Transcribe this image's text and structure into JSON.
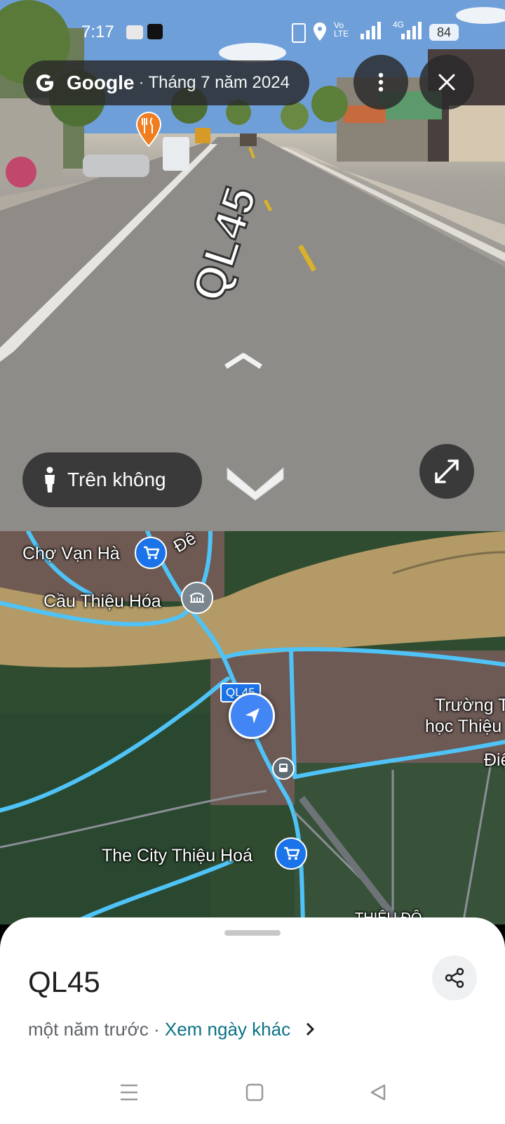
{
  "status_bar": {
    "time": "7:17",
    "network": "4G",
    "volte": "Vo LTE",
    "battery": "84"
  },
  "street_view": {
    "brand": "Google",
    "separator": "·",
    "date": "Tháng 7 năm 2024",
    "road_marking": "QL45",
    "aerial_button_label": "Trên không",
    "icons": [
      "google-g-icon",
      "more-vert-icon",
      "close-icon",
      "person-icon",
      "expand-icon",
      "chevron-up-icon",
      "chevron-down-icon",
      "restaurant-pin-icon"
    ]
  },
  "map": {
    "labels": {
      "cho_van_ha": "Chợ Vạn Hà",
      "de": "Đê",
      "cau_thieu_hoa": "Cầu Thiệu Hóa",
      "truong_1": "Trường T",
      "truong_2": "học Thiệu",
      "di": "Điệ",
      "the_city": "The City Thiệu Hoá",
      "thieu_do": "THIỆU ĐÔ",
      "road_badge": "QL45"
    },
    "colors": {
      "road": "#4fc3f7",
      "river": "#b59a63",
      "pin": "#1a73e8"
    }
  },
  "sheet": {
    "title": "QL45",
    "relative_time": "một năm trước",
    "dot": "·",
    "other_dates_link": "Xem ngày khác"
  },
  "nav_bar": {
    "icons": [
      "menu-icon",
      "home-square-icon",
      "back-triangle-icon"
    ]
  }
}
